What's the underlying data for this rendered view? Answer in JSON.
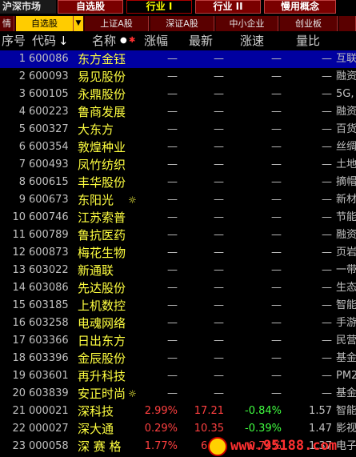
{
  "top": {
    "title": "沪深市场",
    "tabs": [
      {
        "label": "自选股",
        "active": false
      },
      {
        "label": "行业 I",
        "active": true
      },
      {
        "label": "行业 II",
        "active": false
      },
      {
        "label": "慢用概念",
        "active": false
      }
    ]
  },
  "sub": {
    "tabs": [
      "情",
      "自选股",
      "上证A股",
      "深证A股",
      "中小企业",
      "创业板"
    ],
    "active_index": 1
  },
  "header": {
    "idx": "序号",
    "code": "代码",
    "code_sort": "↓",
    "name": "名称",
    "chg": "涨幅",
    "price": "最新",
    "speed": "涨速",
    "ratio": "量比"
  },
  "rows": [
    {
      "idx": "1",
      "code": "600086",
      "name": "东方金钰",
      "star": "",
      "chg": "—",
      "price": "—",
      "speed": "—",
      "ratio": "—",
      "concept": "互联"
    },
    {
      "idx": "2",
      "code": "600093",
      "name": "易见股份",
      "star": "",
      "chg": "—",
      "price": "—",
      "speed": "—",
      "ratio": "—",
      "concept": "融资"
    },
    {
      "idx": "3",
      "code": "600105",
      "name": "永鼎股份",
      "star": "",
      "chg": "—",
      "price": "—",
      "speed": "—",
      "ratio": "—",
      "concept": "5G,"
    },
    {
      "idx": "4",
      "code": "600223",
      "name": "鲁商发展",
      "star": "",
      "chg": "—",
      "price": "—",
      "speed": "—",
      "ratio": "—",
      "concept": "融资"
    },
    {
      "idx": "5",
      "code": "600327",
      "name": "大东方",
      "star": "",
      "chg": "—",
      "price": "—",
      "speed": "—",
      "ratio": "—",
      "concept": "百货"
    },
    {
      "idx": "6",
      "code": "600354",
      "name": "敦煌种业",
      "star": "",
      "chg": "—",
      "price": "—",
      "speed": "—",
      "ratio": "—",
      "concept": "丝绸"
    },
    {
      "idx": "7",
      "code": "600493",
      "name": "凤竹纺织",
      "star": "",
      "chg": "—",
      "price": "—",
      "speed": "—",
      "ratio": "—",
      "concept": "土地"
    },
    {
      "idx": "8",
      "code": "600615",
      "name": "丰华股份",
      "star": "",
      "chg": "—",
      "price": "—",
      "speed": "—",
      "ratio": "—",
      "concept": "摘帽"
    },
    {
      "idx": "9",
      "code": "600673",
      "name": "东阳光",
      "star": "☼",
      "chg": "—",
      "price": "—",
      "speed": "—",
      "ratio": "—",
      "concept": "新材"
    },
    {
      "idx": "10",
      "code": "600746",
      "name": "江苏索普",
      "star": "",
      "chg": "—",
      "price": "—",
      "speed": "—",
      "ratio": "—",
      "concept": "节能"
    },
    {
      "idx": "11",
      "code": "600789",
      "name": "鲁抗医药",
      "star": "",
      "chg": "—",
      "price": "—",
      "speed": "—",
      "ratio": "—",
      "concept": "融资"
    },
    {
      "idx": "12",
      "code": "600873",
      "name": "梅花生物",
      "star": "",
      "chg": "—",
      "price": "—",
      "speed": "—",
      "ratio": "—",
      "concept": "页岩"
    },
    {
      "idx": "13",
      "code": "603022",
      "name": "新通联",
      "star": "",
      "chg": "—",
      "price": "—",
      "speed": "—",
      "ratio": "—",
      "concept": "一带"
    },
    {
      "idx": "14",
      "code": "603086",
      "name": "先达股份",
      "star": "",
      "chg": "—",
      "price": "—",
      "speed": "—",
      "ratio": "—",
      "concept": "生态"
    },
    {
      "idx": "15",
      "code": "603185",
      "name": "上机数控",
      "star": "",
      "chg": "—",
      "price": "—",
      "speed": "—",
      "ratio": "—",
      "concept": "智能"
    },
    {
      "idx": "16",
      "code": "603258",
      "name": "电魂网络",
      "star": "",
      "chg": "—",
      "price": "—",
      "speed": "—",
      "ratio": "—",
      "concept": "手游"
    },
    {
      "idx": "17",
      "code": "603366",
      "name": "日出东方",
      "star": "",
      "chg": "—",
      "price": "—",
      "speed": "—",
      "ratio": "—",
      "concept": "民营"
    },
    {
      "idx": "18",
      "code": "603396",
      "name": "金辰股份",
      "star": "",
      "chg": "—",
      "price": "—",
      "speed": "—",
      "ratio": "—",
      "concept": "基金"
    },
    {
      "idx": "19",
      "code": "603601",
      "name": "再升科技",
      "star": "",
      "chg": "—",
      "price": "—",
      "speed": "—",
      "ratio": "—",
      "concept": "PM2"
    },
    {
      "idx": "20",
      "code": "603839",
      "name": "安正时尚",
      "star": "☼",
      "chg": "—",
      "price": "—",
      "speed": "—",
      "ratio": "—",
      "concept": "基金"
    },
    {
      "idx": "21",
      "code": "000021",
      "name": "深科技",
      "star": "",
      "chg": "2.99%",
      "price": "17.21",
      "speed": "-0.84%",
      "ratio": "1.57",
      "concept": "智能"
    },
    {
      "idx": "22",
      "code": "000027",
      "name": "深大通",
      "star": "",
      "chg": "0.29%",
      "price": "10.35",
      "speed": "-0.39%",
      "ratio": "1.47",
      "concept": "影视"
    },
    {
      "idx": "23",
      "code": "000058",
      "name": "深 赛 格",
      "star": "",
      "chg": "1.77%",
      "price": "6.90",
      "speed": "0.74%",
      "ratio": "1.37",
      "concept": "电子"
    }
  ],
  "watermark": "www.95188.com"
}
